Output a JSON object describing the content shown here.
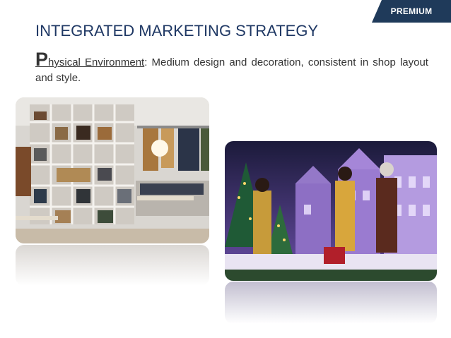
{
  "badge": {
    "label": "PREMIUM",
    "color": "#1f3a5a"
  },
  "slide": {
    "title": "INTEGRATED MARKETING STRATEGY",
    "dropcap": "P",
    "heading_rest": "hysical Environment",
    "body": ": Medium design and decoration, consistent in shop layout and style."
  },
  "images": {
    "left": "store-interior-photo",
    "right": "holiday-window-display-photo"
  },
  "colors": {
    "title": "#1f3864",
    "text": "#333333"
  }
}
